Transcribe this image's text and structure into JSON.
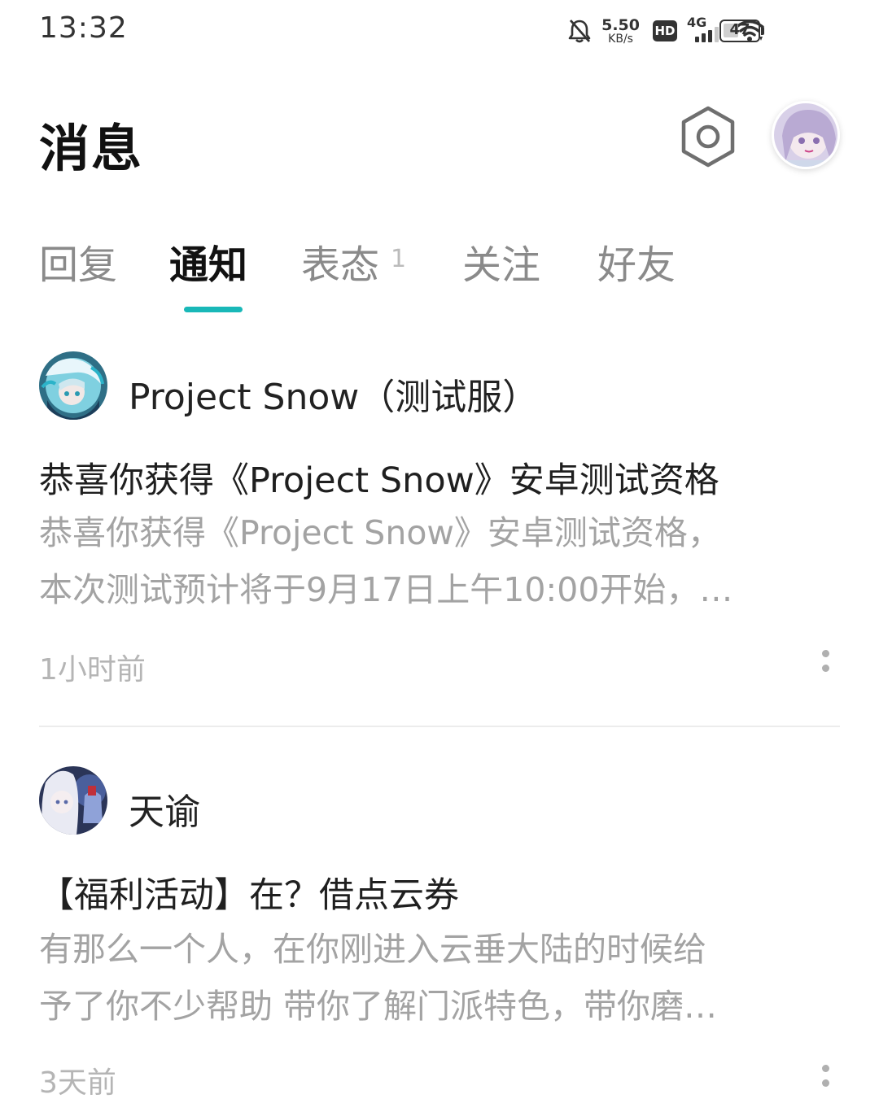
{
  "status_bar": {
    "time": "13:32",
    "speed_value": "5.50",
    "speed_unit": "KB/s",
    "hd_label": "HD",
    "network_label": "4G",
    "battery_level": "47",
    "icons": [
      "bell-off-icon",
      "hd-icon",
      "signal-icon",
      "wifi-icon",
      "battery-icon"
    ]
  },
  "header": {
    "title": "消息",
    "settings_icon": "hexagon-gear-icon",
    "avatar_icon": "user-avatar"
  },
  "tabs": [
    {
      "label": "回复",
      "badge": "",
      "active": false
    },
    {
      "label": "通知",
      "badge": "",
      "active": true
    },
    {
      "label": "表态",
      "badge": "1",
      "active": false
    },
    {
      "label": "关注",
      "badge": "",
      "active": false
    },
    {
      "label": "好友",
      "badge": "",
      "active": false
    }
  ],
  "accent_color": "#19b8b8",
  "notifications": [
    {
      "sender": "Project Snow（测试服）",
      "title": "恭喜你获得《Project Snow》安卓测试资格",
      "body_line1": "恭喜你获得《Project Snow》安卓测试资格，",
      "body_line2": "本次测试预计将于9月17日上午10:00开始，…",
      "time": "1小时前"
    },
    {
      "sender": "天谕",
      "title": "【福利活动】在？借点云券",
      "body_line1": "有那么一个人，在你刚进入云垂大陆的时候给",
      "body_line2": "予了你不少帮助 带你了解门派特色，带你磨…",
      "time": "3天前"
    }
  ]
}
